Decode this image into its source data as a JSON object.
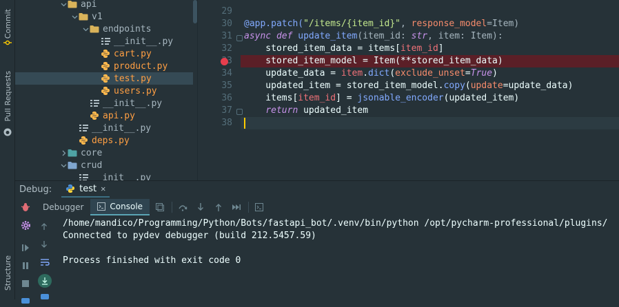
{
  "sidebar": {
    "tabs": [
      {
        "label": "Commit"
      },
      {
        "label": "Pull Requests"
      },
      {
        "label": "Structure"
      }
    ]
  },
  "project_tree": {
    "items": [
      {
        "label": "api",
        "kind": "dir",
        "expanded": true,
        "indent": 4
      },
      {
        "label": "v1",
        "kind": "dir",
        "expanded": true,
        "indent": 5
      },
      {
        "label": "endpoints",
        "kind": "dir",
        "expanded": true,
        "indent": 6
      },
      {
        "label": "__init__.py",
        "kind": "init",
        "indent": 7
      },
      {
        "label": "cart.py",
        "kind": "py",
        "indent": 7
      },
      {
        "label": "product.py",
        "kind": "py",
        "indent": 7
      },
      {
        "label": "test.py",
        "kind": "py",
        "indent": 7,
        "selected": true
      },
      {
        "label": "users.py",
        "kind": "py",
        "indent": 7
      },
      {
        "label": "__init__.py",
        "kind": "init",
        "indent": 6
      },
      {
        "label": "api.py",
        "kind": "py",
        "indent": 6
      },
      {
        "label": "__init__.py",
        "kind": "init",
        "indent": 5
      },
      {
        "label": "deps.py",
        "kind": "py",
        "indent": 5
      },
      {
        "label": "core",
        "kind": "dir",
        "expanded": false,
        "indent": 4
      },
      {
        "label": "crud",
        "kind": "dir",
        "expanded": true,
        "indent": 4
      },
      {
        "label": "__init__.py",
        "kind": "init",
        "indent": 5
      }
    ]
  },
  "editor": {
    "line_numbers": [
      "29",
      "30",
      "31",
      "32",
      "33",
      "34",
      "35",
      "36",
      "37",
      "38"
    ],
    "breakpoint_line": "33",
    "lines": [
      {
        "n": "29",
        "segments": []
      },
      {
        "n": "30",
        "segments": [
          {
            "t": "@app.patch(",
            "c": "t-dec"
          },
          {
            "t": "\"/items/{item_id}\"",
            "c": "t-str"
          },
          {
            "t": ", ",
            "c": "t-def"
          },
          {
            "t": "response_model",
            "c": "t-param"
          },
          {
            "t": "=Item)",
            "c": "t-def"
          }
        ]
      },
      {
        "n": "31",
        "segments": [
          {
            "t": "async def ",
            "c": "t-kw"
          },
          {
            "t": "update_item",
            "c": "t-fn"
          },
          {
            "t": "(item_id: ",
            "c": "t-def"
          },
          {
            "t": "str",
            "c": "t-kw"
          },
          {
            "t": ", item: Item):",
            "c": "t-def"
          }
        ]
      },
      {
        "n": "32",
        "segments": [
          {
            "t": "    stored_item_data = items[",
            "c": "t-plain"
          },
          {
            "t": "item_id",
            "c": "t-par"
          },
          {
            "t": "]",
            "c": "t-plain"
          }
        ]
      },
      {
        "n": "33",
        "segments": [
          {
            "t": "    stored_item_model = Item(**stored_item_data)",
            "c": "t-plain"
          }
        ]
      },
      {
        "n": "34",
        "segments": [
          {
            "t": "    update_data = ",
            "c": "t-plain"
          },
          {
            "t": "item",
            "c": "t-par"
          },
          {
            "t": ".",
            "c": "t-plain"
          },
          {
            "t": "dict",
            "c": "t-fn"
          },
          {
            "t": "(",
            "c": "t-plain"
          },
          {
            "t": "exclude_unset",
            "c": "t-param"
          },
          {
            "t": "=",
            "c": "t-plain"
          },
          {
            "t": "True",
            "c": "t-true"
          },
          {
            "t": ")",
            "c": "t-plain"
          }
        ]
      },
      {
        "n": "35",
        "segments": [
          {
            "t": "    updated_item = stored_item_model.",
            "c": "t-plain"
          },
          {
            "t": "copy",
            "c": "t-fn"
          },
          {
            "t": "(",
            "c": "t-plain"
          },
          {
            "t": "update",
            "c": "t-param"
          },
          {
            "t": "=update_data)",
            "c": "t-plain"
          }
        ]
      },
      {
        "n": "36",
        "segments": [
          {
            "t": "    items[",
            "c": "t-plain"
          },
          {
            "t": "item_id",
            "c": "t-par"
          },
          {
            "t": "] = ",
            "c": "t-plain"
          },
          {
            "t": "jsonable_encoder",
            "c": "t-fn"
          },
          {
            "t": "(updated_item)",
            "c": "t-plain"
          }
        ]
      },
      {
        "n": "37",
        "segments": [
          {
            "t": "    ",
            "c": "t-plain"
          },
          {
            "t": "return",
            "c": "t-kw"
          },
          {
            "t": " updated_item",
            "c": "t-plain"
          }
        ]
      },
      {
        "n": "38",
        "segments": []
      }
    ]
  },
  "debug_panel": {
    "label": "Debug:",
    "run_tab": "test",
    "close_glyph": "✕",
    "tabs": [
      {
        "label": "Debugger",
        "active": false
      },
      {
        "label": "Console",
        "active": true
      }
    ]
  },
  "console": {
    "lines": [
      "/home/mandico/Programming/Python/Bots/fastapi_bot/.venv/bin/python /opt/pycharm-professional/plugins/",
      "Connected to pydev debugger (build 212.5457.59)",
      "",
      "Process finished with exit code 0"
    ]
  },
  "colors": {
    "background": "#263238",
    "python_file": "#ff9f43",
    "breakpoint": "#e63e4d",
    "breakpoint_line": "#5b1f27",
    "caret": "#ffcc00"
  }
}
